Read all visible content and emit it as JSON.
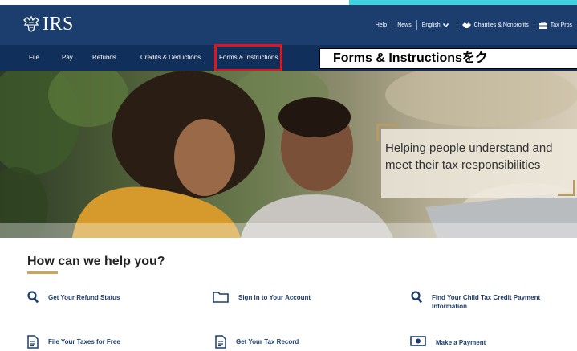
{
  "header": {
    "logo_text": "IRS",
    "utility": {
      "help": "Help",
      "news": "News",
      "language": "English",
      "charities": "Charities & Nonprofits",
      "tax_pros": "Tax Pros"
    }
  },
  "nav": {
    "items": [
      {
        "label": "File"
      },
      {
        "label": "Pay"
      },
      {
        "label": "Refunds"
      },
      {
        "label": "Credits & Deductions"
      },
      {
        "label": "Forms & Instructions"
      }
    ]
  },
  "annotation": {
    "text": "Forms & Instructionsをク"
  },
  "hero": {
    "line1": "Helping people understand and",
    "line2": "meet their tax responsibilities"
  },
  "help": {
    "title": "How can we help you?",
    "links": [
      {
        "label": "Get Your Refund Status",
        "icon": "search-icon"
      },
      {
        "label": "Sign in to Your Account",
        "icon": "folder-icon"
      },
      {
        "label": "Find Your Child Tax Credit Payment Information",
        "icon": "search-icon"
      },
      {
        "label": "File Your Taxes for Free",
        "icon": "document-icon"
      },
      {
        "label": "Get Your Tax Record",
        "icon": "document-icon"
      },
      {
        "label": "Make a Payment",
        "icon": "money-icon"
      }
    ]
  },
  "colors": {
    "header_bg": "#1c3e6e",
    "nav_bg": "#10305b",
    "highlight_red": "#e3141b",
    "accent_gold": "#c9a758",
    "top_strip": "#3fd3e0"
  }
}
